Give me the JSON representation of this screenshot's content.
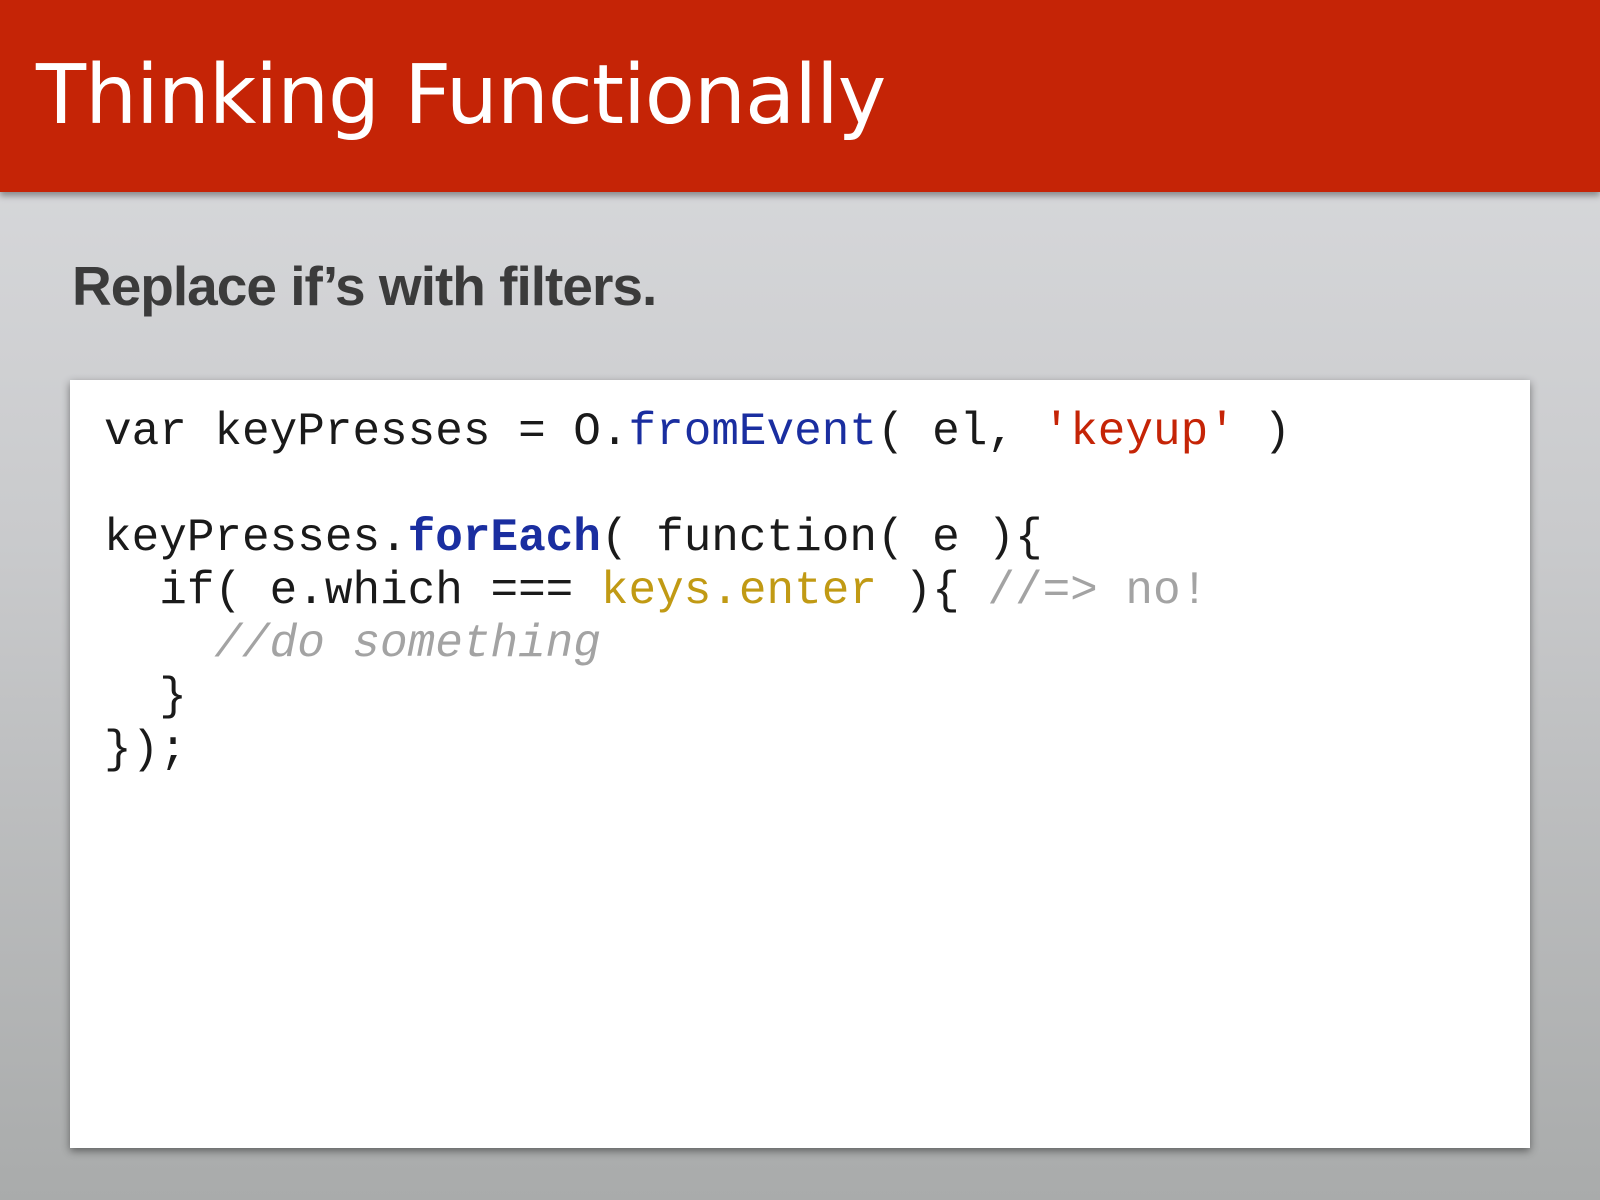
{
  "slide": {
    "title": "Thinking Functionally",
    "subtitle": "Replace if’s with filters."
  },
  "code": {
    "line1": {
      "a": "var keyPresses = O.",
      "method": "fromEvent",
      "b": "( el, ",
      "string": "'keyup'",
      "c": " )"
    },
    "line2": "",
    "line3": {
      "a": "keyPresses.",
      "method": "forEach",
      "b": "( function( e ){"
    },
    "line4": {
      "a": "  if( e.which === ",
      "gold": "keys.enter",
      "b": " ){ ",
      "comment": "//=> no!"
    },
    "line5": {
      "indent": "    ",
      "comment": "//do something"
    },
    "line6": "  }",
    "line7": "});"
  },
  "colors": {
    "title_bar": "#c52406",
    "method": "#1a2ea0",
    "string": "#c52406",
    "property": "#c19a14",
    "comment": "#a3a3a3"
  }
}
